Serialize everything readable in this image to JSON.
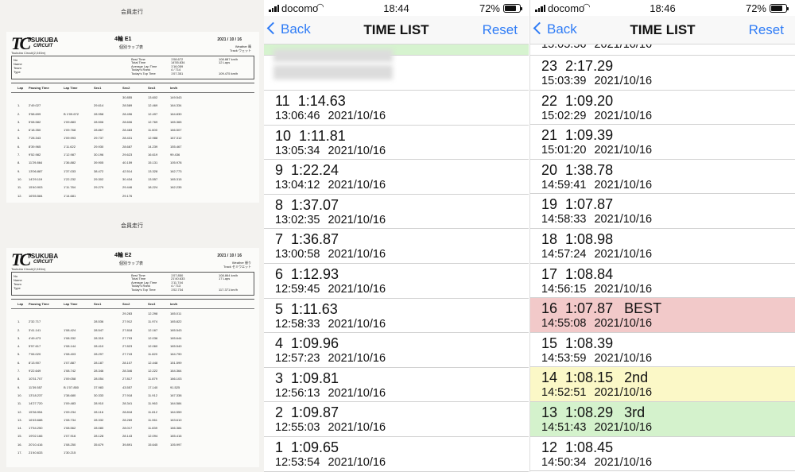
{
  "paper": {
    "caption": "会員走行",
    "logo_text": "TSUKUBA",
    "logo_sub": "CIRCUIT",
    "circuit": "Tsukuba Circuit(2,045m)",
    "subtitle": "個別ラップ表",
    "sheets": [
      {
        "title": "4輪 E1",
        "date": "2021 / 10 / 16",
        "weather": "Weather 晴",
        "track": "Track ウェット",
        "info_labels": [
          "No",
          "Name",
          "Team",
          "Type"
        ],
        "info_mid_labels": [
          "Best Time",
          "Total Time",
          "Average Lap Time",
          "Today's Rank",
          "Today's Top Time"
        ],
        "info_mid_values": [
          "1'08.672",
          "14'55.834",
          "1'16.059",
          "4 / 714",
          "1'07.351"
        ],
        "info_right": [
          "108.887 km/h",
          "12 Laps",
          "",
          "",
          "109.475 km/h"
        ],
        "header": [
          "Lap",
          "Passing Time",
          "Lap Time",
          "Sec1",
          "Sec2",
          "Sec3",
          "km/h"
        ],
        "rows": [
          [
            "",
            "",
            "",
            "",
            "30.855",
            "13.602",
            "149.543"
          ],
          [
            "1.",
            "2'49.027",
            "",
            "29.614",
            "28.589",
            "12.469",
            "164.334"
          ],
          [
            "2.",
            "3'58.699",
            "B 1'09.672",
            "28.958",
            "28.496",
            "12.497",
            "164.830"
          ],
          [
            "3.",
            "5'08.582",
            "1'09.883",
            "28.506",
            "28.606",
            "12.769",
            "165.365"
          ],
          [
            "4.",
            "6'18.350",
            "1'09.768",
            "28.867",
            "28.483",
            "11.600",
            "166.507"
          ],
          [
            "5.",
            "7'28.343",
            "1'09.993",
            "29.737",
            "28.431",
            "12.988",
            "167.312"
          ],
          [
            "6.",
            "8'39.965",
            "1'11.622",
            "29.930",
            "28.687",
            "14.239",
            "155.467"
          ],
          [
            "7.",
            "9'52.982",
            "1'12.987",
            "30.196",
            "29.623",
            "16.619",
            "99.436"
          ],
          [
            "8.",
            "11'29.864",
            "1'36.882",
            "39.905",
            "40.159",
            "15.131",
            "105.978"
          ],
          [
            "9.",
            "13'06.887",
            "1'37.033",
            "38.472",
            "42.514",
            "13.328",
            "162.773"
          ],
          [
            "10.",
            "14'29.119",
            "1'22.232",
            "29.302",
            "30.434",
            "13.557",
            "165.315"
          ],
          [
            "11.",
            "15'40.903",
            "1'11.784",
            "29.279",
            "29.446",
            "18.224",
            "162.235"
          ],
          [
            "12.",
            "16'55.584",
            "1'14.681",
            "",
            "29.176",
            "",
            ""
          ]
        ]
      },
      {
        "title": "4輪 E2",
        "date": "2021 / 10 / 16",
        "weather": "Weather 曇り",
        "track": "Track セミウエット",
        "info_labels": [
          "No",
          "Name",
          "Team",
          "Type"
        ],
        "info_mid_labels": [
          "Best Time",
          "Total Time",
          "Average Lap Time",
          "Today's Rank",
          "Today's Top Time"
        ],
        "info_mid_values": [
          "1'07.850",
          "21'40.633",
          "1'11.744",
          "4 / 713",
          "1'02.734"
        ],
        "info_right": [
          "108.864 km/h",
          "17 Laps",
          "",
          "",
          "117.371 km/h"
        ],
        "header": [
          "Lap",
          "Passing Time",
          "Lap Time",
          "Sec1",
          "Sec2",
          "Sec3",
          "km/h"
        ],
        "rows": [
          [
            "",
            "",
            "",
            "",
            "29.283",
            "12.298",
            "165.011"
          ],
          [
            "1.",
            "2'32.717",
            "",
            "28.536",
            "27.912",
            "11.974",
            "165.822"
          ],
          [
            "2.",
            "3'41.141",
            "1'08.424",
            "28.547",
            "27.818",
            "12.167",
            "165.543"
          ],
          [
            "3.",
            "4'49.473",
            "1'08.332",
            "28.315",
            "27.793",
            "12.036",
            "165.644"
          ],
          [
            "4.",
            "5'57.617",
            "1'08.144",
            "28.410",
            "27.823",
            "12.060",
            "165.540"
          ],
          [
            "5.",
            "7'06.020",
            "1'08.403",
            "28.297",
            "27.743",
            "11.820",
            "164.790"
          ],
          [
            "6.",
            "8'13.907",
            "1'07.887",
            "28.187",
            "28.107",
            "12.448",
            "151.599"
          ],
          [
            "7.",
            "9'22.649",
            "1'08.742",
            "28.346",
            "28.346",
            "12.222",
            "164.364"
          ],
          [
            "8.",
            "10'31.707",
            "1'09.058",
            "28.054",
            "27.817",
            "11.879",
            "166.103"
          ],
          [
            "9.",
            "11'39.557",
            "B 1'07.850",
            "37.983",
            "43.557",
            "17.140",
            "91.525"
          ],
          [
            "10.",
            "13'18.237",
            "1'38.680",
            "30.333",
            "27.918",
            "11.912",
            "167.338"
          ],
          [
            "11.",
            "14'27.720",
            "1'09.483",
            "28.910",
            "28.341",
            "11.963",
            "164.584"
          ],
          [
            "12.",
            "15'36.954",
            "1'09.234",
            "28.116",
            "28.818",
            "11.812",
            "164.559"
          ],
          [
            "13.",
            "16'45.688",
            "1'08.734",
            "28.332",
            "28.269",
            "11.061",
            "163.610"
          ],
          [
            "14.",
            "17'54.250",
            "1'08.562",
            "28.080",
            "28.017",
            "11.839",
            "166.384"
          ],
          [
            "15.",
            "19'02.166",
            "1'07.916",
            "28.128",
            "28.143",
            "12.094",
            "165.416"
          ],
          [
            "16.",
            "20'10.416",
            "1'08.250",
            "35.679",
            "39.891",
            "15.645",
            "105.997"
          ],
          [
            "17.",
            "21'40.633",
            "1'30.215",
            "",
            "",
            "",
            ""
          ]
        ]
      }
    ]
  },
  "phone1": {
    "status": {
      "carrier": "docomo",
      "time": "18:44",
      "battery": "72%"
    },
    "nav": {
      "back": "Back",
      "title": "TIME LIST",
      "reset": "Reset"
    },
    "rows": [
      {
        "lap": "11",
        "time": "1:14.63",
        "clock": "13:06:46",
        "date": "2021/10/16",
        "tag": "",
        "style": ""
      },
      {
        "lap": "10",
        "time": "1:11.81",
        "clock": "13:05:34",
        "date": "2021/10/16",
        "tag": "",
        "style": ""
      },
      {
        "lap": "9",
        "time": "1:22.24",
        "clock": "13:04:12",
        "date": "2021/10/16",
        "tag": "",
        "style": ""
      },
      {
        "lap": "8",
        "time": "1:37.07",
        "clock": "13:02:35",
        "date": "2021/10/16",
        "tag": "",
        "style": ""
      },
      {
        "lap": "7",
        "time": "1:36.87",
        "clock": "13:00:58",
        "date": "2021/10/16",
        "tag": "",
        "style": ""
      },
      {
        "lap": "6",
        "time": "1:12.93",
        "clock": "12:59:45",
        "date": "2021/10/16",
        "tag": "",
        "style": ""
      },
      {
        "lap": "5",
        "time": "1:11.63",
        "clock": "12:58:33",
        "date": "2021/10/16",
        "tag": "",
        "style": ""
      },
      {
        "lap": "4",
        "time": "1:09.96",
        "clock": "12:57:23",
        "date": "2021/10/16",
        "tag": "",
        "style": ""
      },
      {
        "lap": "3",
        "time": "1:09.81",
        "clock": "12:56:13",
        "date": "2021/10/16",
        "tag": "",
        "style": ""
      },
      {
        "lap": "2",
        "time": "1:09.87",
        "clock": "12:55:03",
        "date": "2021/10/16",
        "tag": "",
        "style": ""
      },
      {
        "lap": "1",
        "time": "1:09.65",
        "clock": "12:53:54",
        "date": "2021/10/16",
        "tag": "",
        "style": ""
      }
    ]
  },
  "phone2": {
    "status": {
      "carrier": "docomo",
      "time": "18:46",
      "battery": "72%"
    },
    "nav": {
      "back": "Back",
      "title": "TIME LIST",
      "reset": "Reset"
    },
    "top_partial": {
      "clock": "15:05:56",
      "date": "2021/10/16"
    },
    "rows": [
      {
        "lap": "23",
        "time": "2:17.29",
        "clock": "15:03:39",
        "date": "2021/10/16",
        "tag": "",
        "style": ""
      },
      {
        "lap": "22",
        "time": "1:09.20",
        "clock": "15:02:29",
        "date": "2021/10/16",
        "tag": "",
        "style": ""
      },
      {
        "lap": "21",
        "time": "1:09.39",
        "clock": "15:01:20",
        "date": "2021/10/16",
        "tag": "",
        "style": ""
      },
      {
        "lap": "20",
        "time": "1:38.78",
        "clock": "14:59:41",
        "date": "2021/10/16",
        "tag": "",
        "style": ""
      },
      {
        "lap": "19",
        "time": "1:07.87",
        "clock": "14:58:33",
        "date": "2021/10/16",
        "tag": "",
        "style": ""
      },
      {
        "lap": "18",
        "time": "1:08.98",
        "clock": "14:57:24",
        "date": "2021/10/16",
        "tag": "",
        "style": ""
      },
      {
        "lap": "17",
        "time": "1:08.84",
        "clock": "14:56:15",
        "date": "2021/10/16",
        "tag": "",
        "style": ""
      },
      {
        "lap": "16",
        "time": "1:07.87",
        "clock": "14:55:08",
        "date": "2021/10/16",
        "tag": "BEST",
        "style": "best"
      },
      {
        "lap": "15",
        "time": "1:08.39",
        "clock": "14:53:59",
        "date": "2021/10/16",
        "tag": "",
        "style": ""
      },
      {
        "lap": "14",
        "time": "1:08.15",
        "clock": "14:52:51",
        "date": "2021/10/16",
        "tag": "2nd",
        "style": "second"
      },
      {
        "lap": "13",
        "time": "1:08.29",
        "clock": "14:51:43",
        "date": "2021/10/16",
        "tag": "3rd",
        "style": "third"
      },
      {
        "lap": "12",
        "time": "1:08.45",
        "clock": "14:50:34",
        "date": "2021/10/16",
        "tag": "",
        "style": ""
      }
    ]
  },
  "colors": {
    "accent": "#2f7cf6",
    "best": "#f2c9c9",
    "second": "#fbf8c7",
    "third": "#d4f2cc"
  }
}
